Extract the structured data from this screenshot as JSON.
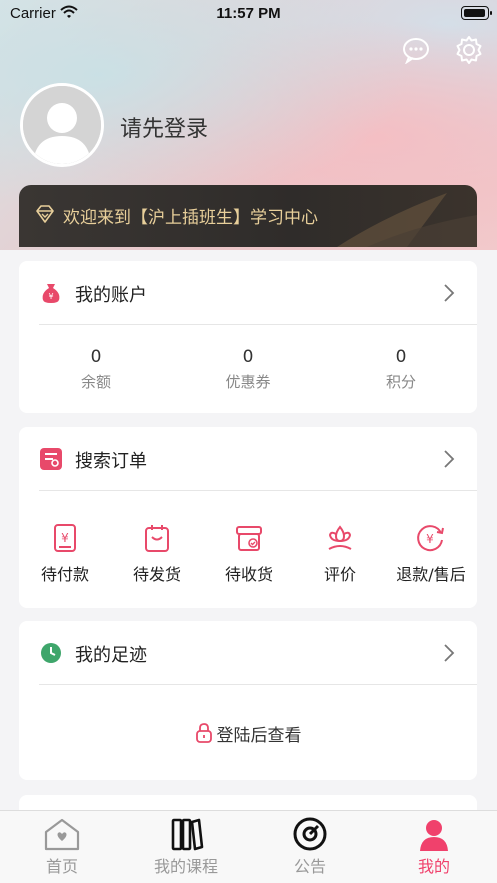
{
  "status_bar": {
    "carrier": "Carrier",
    "time": "11:57 PM"
  },
  "header": {
    "login_prompt": "请先登录"
  },
  "banner": {
    "text": "欢迎来到【沪上插班生】学习中心",
    "text_color": "#e8cf9a"
  },
  "account": {
    "title": "我的账户",
    "stats": [
      {
        "value": "0",
        "label": "余额"
      },
      {
        "value": "0",
        "label": "优惠券"
      },
      {
        "value": "0",
        "label": "积分"
      }
    ]
  },
  "orders": {
    "title": "搜索订单",
    "items": [
      {
        "label": "待付款",
        "icon": "pending-payment-icon"
      },
      {
        "label": "待发货",
        "icon": "pending-shipment-icon"
      },
      {
        "label": "待收货",
        "icon": "pending-receipt-icon"
      },
      {
        "label": "评价",
        "icon": "review-icon"
      },
      {
        "label": "退款/售后",
        "icon": "refund-icon"
      }
    ]
  },
  "footprint": {
    "title": "我的足迹",
    "login_view": "登陆后查看"
  },
  "tabbar": {
    "items": [
      {
        "label": "首页",
        "icon": "home-icon"
      },
      {
        "label": "我的课程",
        "icon": "courses-icon"
      },
      {
        "label": "公告",
        "icon": "announcement-icon"
      },
      {
        "label": "我的",
        "icon": "profile-icon"
      }
    ],
    "active_index": 3,
    "active_color": "#f0416c"
  },
  "accent_color": "#e8496a"
}
